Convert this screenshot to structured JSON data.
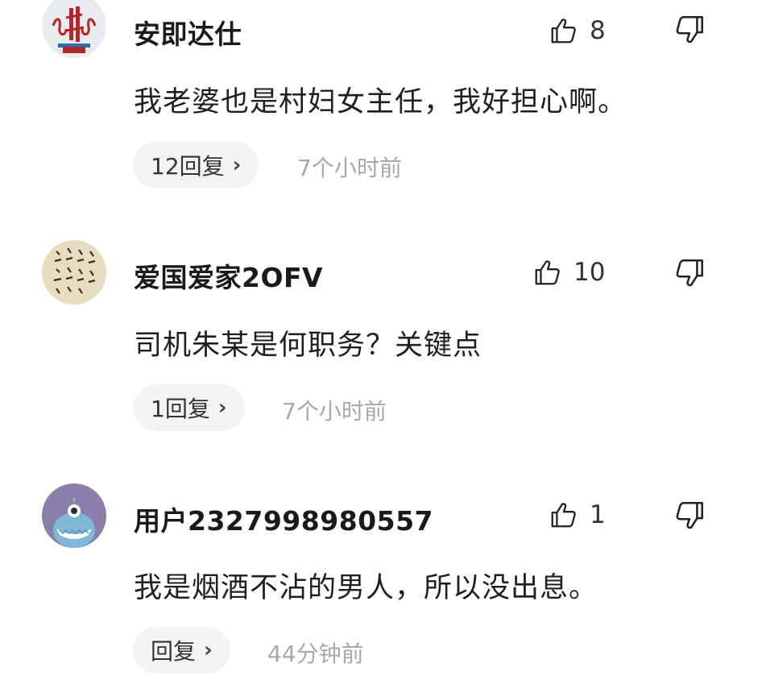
{
  "comments": [
    {
      "username": "安即达仕",
      "likes": "8",
      "text": "我老婆也是村妇女主任，我好担心啊。",
      "reply_label": "12回复",
      "time": "7个小时前",
      "avatar_icon": "calligraphy-seal-avatar"
    },
    {
      "username": "爱国爱家2OFV",
      "likes": "10",
      "text": "司机朱某是何职务？关键点",
      "reply_label": "1回复",
      "time": "7个小时前",
      "avatar_icon": "calligraphy-scroll-avatar"
    },
    {
      "username": "用户2327998980557",
      "likes": "1",
      "text": "我是烟酒不沾的男人，所以没出息。",
      "reply_label": "回复",
      "time": "44分钟前",
      "avatar_icon": "blue-monster-avatar"
    }
  ],
  "icons": {
    "like": "thumbs-up-icon",
    "dislike": "thumbs-down-icon",
    "chevron": "chevron-right-icon"
  },
  "colors": {
    "background": "#ffffff",
    "reply_pill": "#f3f3f3",
    "time_text": "#a8a8a8"
  }
}
